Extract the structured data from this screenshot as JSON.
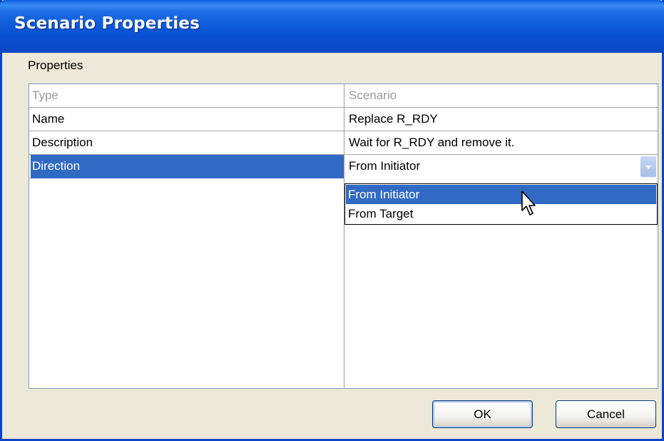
{
  "window": {
    "title": "Scenario Properties"
  },
  "properties": {
    "label": "Properties",
    "columns": [
      "Type",
      "Scenario"
    ],
    "rows": [
      {
        "type": "Name",
        "value": "Replace R_RDY"
      },
      {
        "type": "Description",
        "value": "Wait for R_RDY and remove it."
      },
      {
        "type": "Direction",
        "value": "From Initiator"
      }
    ],
    "direction_options": [
      "From Initiator",
      "From Target"
    ],
    "highlighted_option": "From Initiator"
  },
  "buttons": {
    "ok": "OK",
    "cancel": "Cancel"
  },
  "colors": {
    "title_bar": "#0b56d6",
    "selection": "#316ac5",
    "background": "#ece9d8"
  },
  "icons": {
    "cursor": "mouse-pointer-icon",
    "dropdown_arrow": "chevron-down-icon"
  }
}
